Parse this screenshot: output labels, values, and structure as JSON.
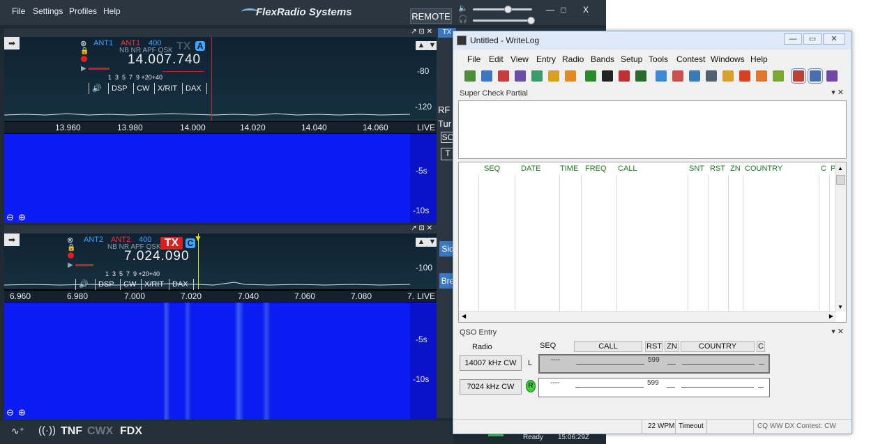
{
  "flex": {
    "menu": [
      "File",
      "Settings",
      "Profiles",
      "Help"
    ],
    "brand": "FlexRadio Systems",
    "remote_label": "REMOTE",
    "window_controls": {
      "minimize": "—",
      "maximize": "□",
      "close": "X"
    },
    "strip": {
      "tx": "TX",
      "rf": "RF",
      "tun": "Tur",
      "so": "SC",
      "t": "T",
      "side": "Sid",
      "break": "Bre"
    },
    "panadapter_a": {
      "ant": "ANT1",
      "ant_rx": "ANT1",
      "filter": "400",
      "modes": "NB NR APF QSK",
      "tx": "TX",
      "slice": "A",
      "frequency": "14.007.740",
      "smeter_scale": "1  3  5  7  9 +20+40",
      "buttons": [
        "DSP",
        "CW",
        "X/RIT",
        "DAX"
      ],
      "dbm_labels": [
        "-80",
        "-120"
      ],
      "scale_ticks": [
        "13.960",
        "13.980",
        "14.000",
        "14.020",
        "14.040",
        "14.060"
      ],
      "live": "LIVE",
      "wf_times": [
        "-5s",
        "-10s"
      ]
    },
    "panadapter_b": {
      "ant": "ANT2",
      "ant_rx": "ANT2",
      "filter": "400",
      "modes": "NB NR APF QSK",
      "tx": "TX",
      "slice": "C",
      "frequency": "7.024.090",
      "smeter_scale": "1  3  5  7  9 +20+40",
      "buttons": [
        "DSP",
        "CW",
        "X/RIT",
        "DAX"
      ],
      "dbm_labels": [
        "-100"
      ],
      "scale_ticks": [
        "6.960",
        "6.980",
        "7.000",
        "7.020",
        "7.040",
        "7.060",
        "7.080",
        "7."
      ],
      "live": "LIVE",
      "wf_times": [
        "-5s",
        "-10s"
      ]
    },
    "bottom": {
      "tnf": "TNF",
      "cwx": "CWX",
      "fdx": "FDX",
      "ready": "Ready",
      "time": "15:06:29Z"
    }
  },
  "writelog": {
    "title": "Untitled - WriteLog",
    "menu": [
      "File",
      "Edit",
      "View",
      "Entry",
      "Radio",
      "Bands",
      "Setup",
      "Tools",
      "Contest",
      "Windows",
      "Help"
    ],
    "toolbar_icons": [
      "new-icon",
      "open-icon",
      "save-icon",
      "antenna-icon",
      "globe-icon",
      "key-icon",
      "briefcase-icon",
      "target-icon",
      "checker-icon",
      "radio-icon",
      "meter-icon",
      "bars-icon",
      "calendar-icon",
      "compass-icon",
      "list-icon",
      "pencil-icon",
      "pin-icon",
      "cloud-icon",
      "wave-icon",
      "operator-icon",
      "window-icon",
      "chat-icon"
    ],
    "toolbar_colors": [
      "#4a8e3c",
      "#3c78c2",
      "#c83c3c",
      "#6a4ea8",
      "#3a9a6a",
      "#d8a020",
      "#e08a20",
      "#2a8a2a",
      "#222222",
      "#c03030",
      "#2a6a2a",
      "#3a8ad8",
      "#c85050",
      "#3a7ab8",
      "#506070",
      "#d8a030",
      "#d84020",
      "#e07830",
      "#7aa830",
      "#c04030",
      "#4870b0",
      "#7048a8"
    ],
    "scp": {
      "title": "Super Check Partial",
      "controls": "▾ ✕"
    },
    "log_headers": [
      "SEQ",
      "DATE",
      "TIME",
      "FREQ",
      "CALL",
      "SNT",
      "RST",
      "ZN",
      "COUNTRY",
      "C",
      "P"
    ],
    "qso": {
      "title": "QSO Entry",
      "controls": "▾ ✕",
      "radio_label": "Radio",
      "headers": [
        "SEQ",
        "CALL",
        "RST",
        "ZN",
        "COUNTRY",
        "C"
      ],
      "radio_1": "14007 kHz CW",
      "radio_2": "7024 kHz CW",
      "radio_1_flag": "L",
      "radio_2_flag": "R",
      "row_1": {
        "seq": "----",
        "rst": "599"
      },
      "row_2": {
        "seq": "----",
        "rst": "599"
      }
    },
    "status": {
      "wpm": "22 WPM",
      "timeout": "Timeout",
      "contest": "CQ WW DX Contest: CW"
    }
  }
}
